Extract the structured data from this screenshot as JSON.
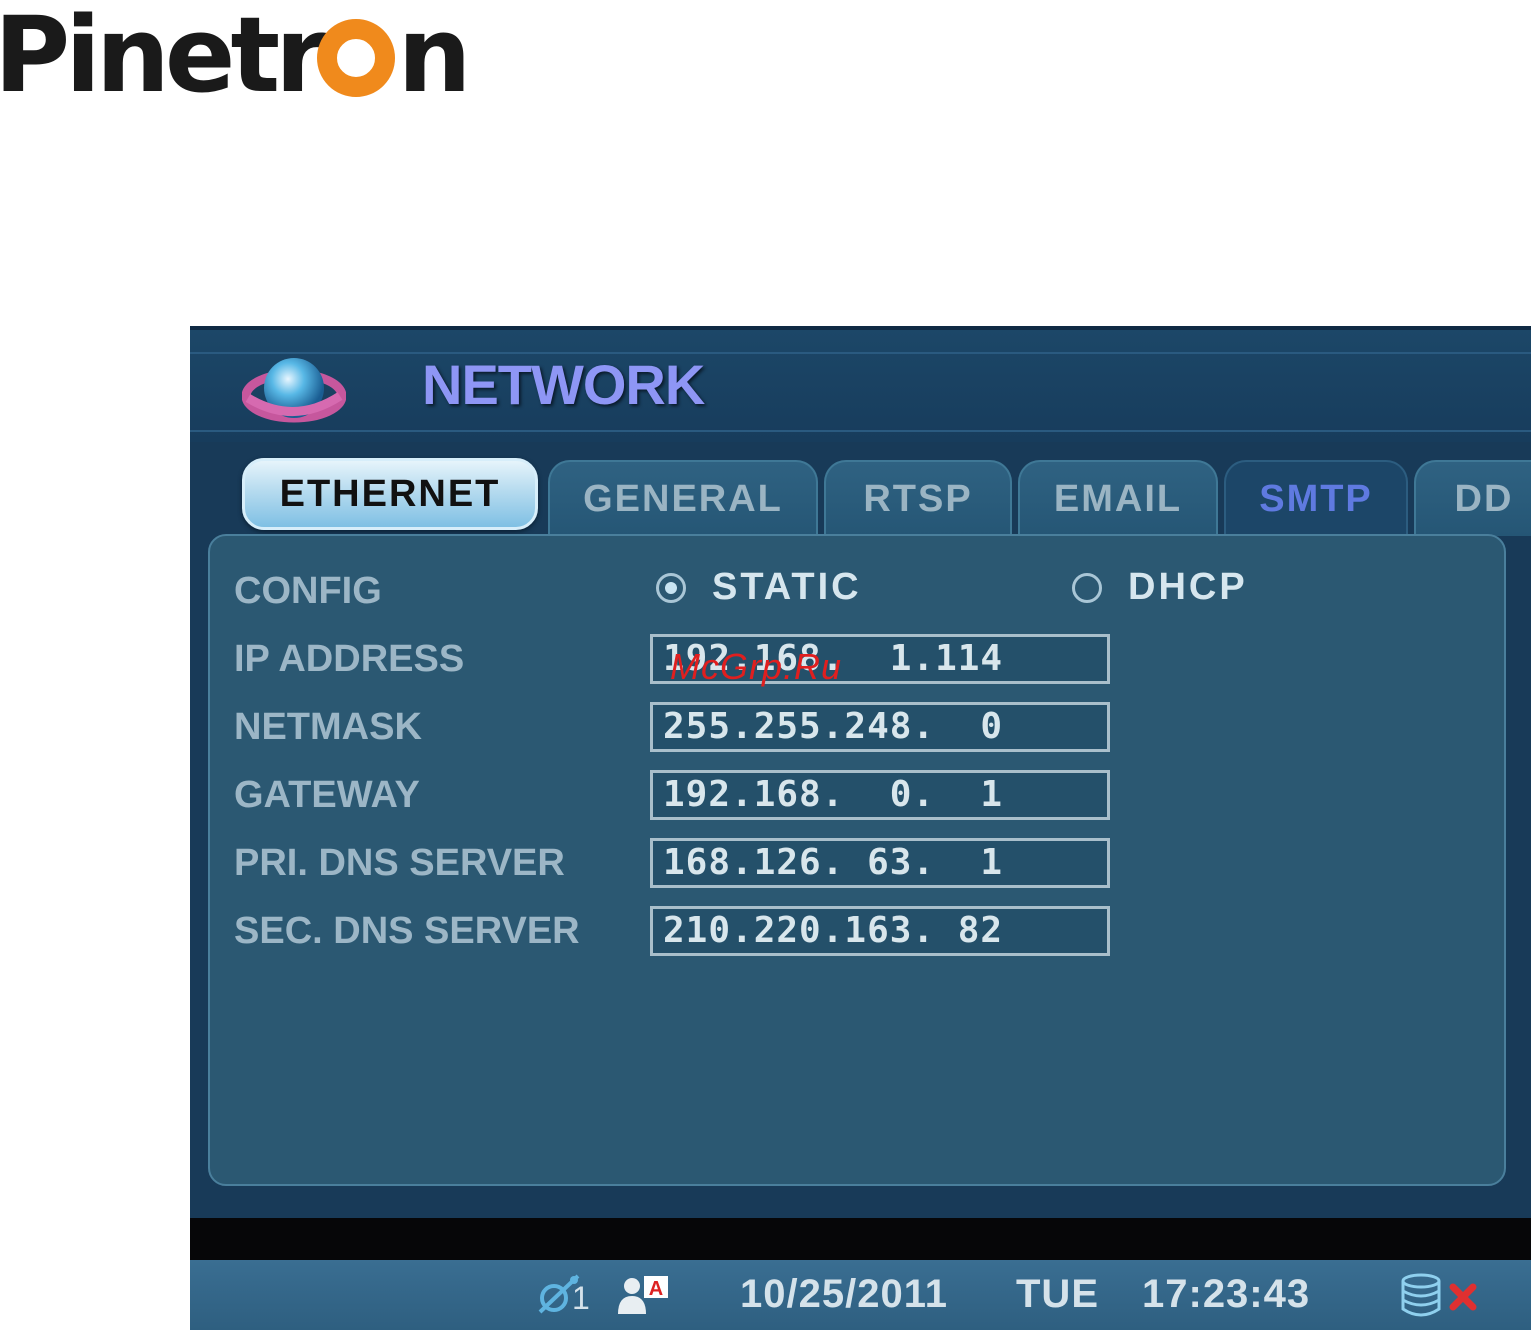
{
  "logo": {
    "text_before": "Pinetr",
    "text_after": "n",
    "accent_color": "#f08a1c"
  },
  "window": {
    "title": "NETWORK"
  },
  "tabs": [
    {
      "label": "ETHERNET",
      "active": true
    },
    {
      "label": "GENERAL",
      "active": false
    },
    {
      "label": "RTSP",
      "active": false
    },
    {
      "label": "EMAIL",
      "active": false
    },
    {
      "label": "SMTP",
      "active": false
    },
    {
      "label": "DD",
      "active": false
    }
  ],
  "config": {
    "label": "CONFIG",
    "options": [
      {
        "label": "STATIC",
        "selected": true
      },
      {
        "label": "DHCP",
        "selected": false
      }
    ]
  },
  "fields": [
    {
      "label": "IP ADDRESS",
      "value": "192.168.  1.114"
    },
    {
      "label": "NETMASK",
      "value": "255.255.248.  0"
    },
    {
      "label": "GATEWAY",
      "value": "192.168.  0.  1"
    },
    {
      "label": "PRI. DNS SERVER",
      "value": "168.126. 63.  1"
    },
    {
      "label": "SEC. DNS SERVER",
      "value": "210.220.163. 82"
    }
  ],
  "watermark": "McGrp.Ru",
  "status": {
    "network_count": "1",
    "date": "10/25/2011",
    "day": "TUE",
    "time": "17:23:43",
    "icons": [
      "network-icon",
      "user-admin-icon",
      "database-icon",
      "error-x-icon"
    ]
  }
}
